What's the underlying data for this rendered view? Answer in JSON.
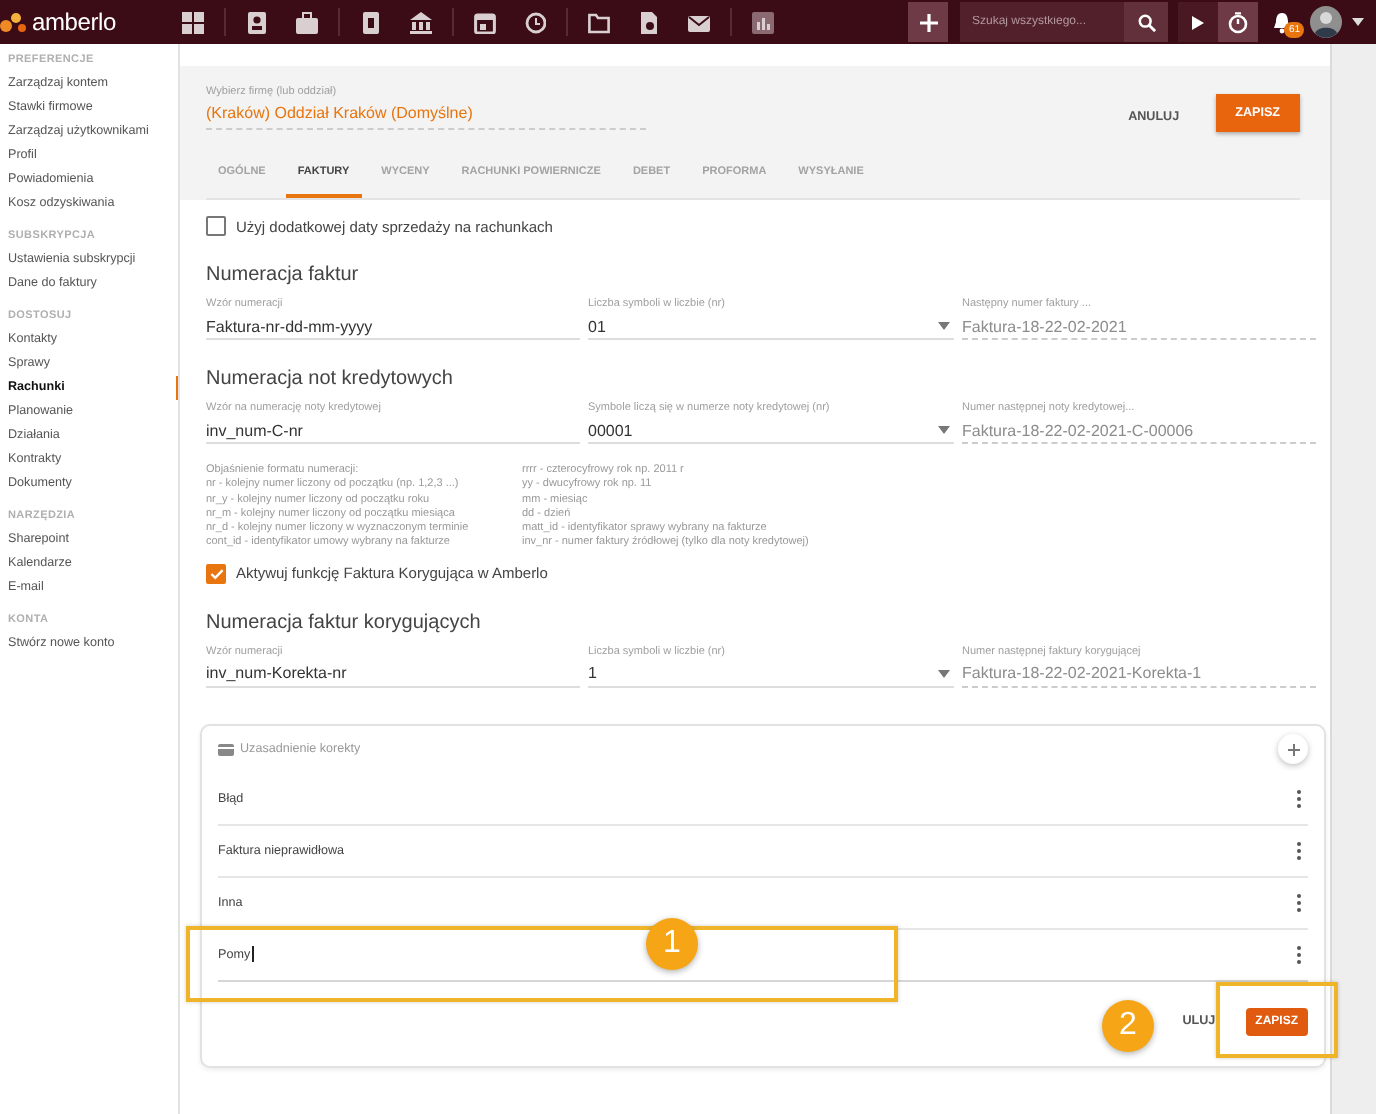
{
  "topbar": {
    "logo": "amberlo",
    "search": {
      "placeholder": "Szukaj wszystkiego..."
    },
    "notifications": "61"
  },
  "sidebar": {
    "sections": [
      {
        "title": "PREFERENCJE",
        "items": [
          {
            "label": "Zarządzaj kontem",
            "selected": false
          },
          {
            "label": "Stawki firmowe",
            "selected": false
          },
          {
            "label": "Zarządzaj użytkownikami",
            "selected": false
          },
          {
            "label": "Profil",
            "selected": false
          },
          {
            "label": "Powiadomienia",
            "selected": false
          },
          {
            "label": "Kosz odzyskiwania",
            "selected": false
          }
        ]
      },
      {
        "title": "SUBSKRYPCJA",
        "items": [
          {
            "label": "Ustawienia subskrypcji",
            "selected": false
          },
          {
            "label": "Dane do faktury",
            "selected": false
          }
        ]
      },
      {
        "title": "DOSTOSUJ",
        "items": [
          {
            "label": "Kontakty",
            "selected": false
          },
          {
            "label": "Sprawy",
            "selected": false
          },
          {
            "label": "Rachunki",
            "selected": true
          },
          {
            "label": "Planowanie",
            "selected": false
          },
          {
            "label": "Działania",
            "selected": false
          },
          {
            "label": "Kontrakty",
            "selected": false
          },
          {
            "label": "Dokumenty",
            "selected": false
          }
        ]
      },
      {
        "title": "NARZĘDZIA",
        "items": [
          {
            "label": "Sharepoint",
            "selected": false
          },
          {
            "label": "Kalendarze",
            "selected": false
          },
          {
            "label": "E-mail",
            "selected": false
          }
        ]
      },
      {
        "title": "KONTA",
        "items": [
          {
            "label": "Stwórz nowe konto",
            "selected": false
          }
        ]
      }
    ]
  },
  "company": {
    "label": "Wybierz firmę (lub oddział)",
    "value": "(Kraków) Oddział Kraków (Domyślne)"
  },
  "header_actions": {
    "cancel": "ANULUJ",
    "save": "ZAPISZ"
  },
  "tabs": [
    {
      "label": "OGÓLNE",
      "selected": false
    },
    {
      "label": "FAKTURY",
      "selected": true
    },
    {
      "label": "WYCENY",
      "selected": false
    },
    {
      "label": "RACHUNKI POWIERNICZE",
      "selected": false
    },
    {
      "label": "DEBET",
      "selected": false
    },
    {
      "label": "PROFORMA",
      "selected": false
    },
    {
      "label": "WYSYŁANIE",
      "selected": false
    }
  ],
  "extra_sale_date": {
    "label": "Użyj dodatkowej daty sprzedaży na rachunkach",
    "checked": false
  },
  "invoice_numbering": {
    "title": "Numeracja faktur",
    "fields": [
      {
        "kind": "text",
        "label": "Wzór numeracji",
        "value": "Faktura-nr-dd-mm-yyyy"
      },
      {
        "kind": "select",
        "label": "Liczba symboli w liczbie (nr)",
        "value": "01"
      },
      {
        "kind": "readonly",
        "label": "Następny numer faktury ...",
        "value": "Faktura-18-22-02-2021"
      }
    ]
  },
  "credit_note_numbering": {
    "title": "Numeracja not kredytowych",
    "fields": [
      {
        "kind": "text",
        "label": "Wzór na numerację noty kredytowej",
        "value": "inv_num-C-nr"
      },
      {
        "kind": "select",
        "label": "Symbole liczą się w numerze noty kredytowej (nr)",
        "value": "00001"
      },
      {
        "kind": "readonly",
        "label": "Numer następnej noty kredytowej...",
        "value": "Faktura-18-22-02-2021-C-00006"
      }
    ]
  },
  "format_legend": {
    "columns": [
      [
        "Objaśnienie formatu numeracji:",
        "nr - kolejny numer liczony od początku (np. 1,2,3 ...)",
        "nr_y - kolejny numer liczony od początku roku",
        "nr_m - kolejny numer liczony od początku miesiąca",
        "nr_d - kolejny numer liczony w wyznaczonym terminie",
        "cont_id - identyfikator umowy wybrany na fakturze"
      ],
      [
        "rrrr - czterocyfrowy rok np. 2011 r",
        "yy - dwucyfrowy rok np. 11",
        "mm - miesiąc",
        "dd - dzień",
        "matt_id - identyfikator sprawy wybrany na fakturze",
        "inv_nr - numer faktury źródłowej (tylko dla noty kredytowej)"
      ]
    ]
  },
  "corrective_invoice": {
    "label": "Aktywuj funkcję Faktura Korygująca w Amberlo",
    "checked": true
  },
  "corrective_numbering": {
    "title": "Numeracja faktur korygujących",
    "fields": [
      {
        "kind": "text",
        "label": "Wzór numeracji",
        "value": "inv_num-Korekta-nr"
      },
      {
        "kind": "select",
        "label": "Liczba symboli w liczbie (nr)",
        "value": "1"
      },
      {
        "kind": "readonly",
        "label": "Numer następnej faktury korygującej",
        "value": "Faktura-18-22-02-2021-Korekta-1"
      }
    ]
  },
  "correction_reasons": {
    "title": "Uzasadnienie korekty",
    "items": [
      {
        "kind": "text",
        "value": "Błąd"
      },
      {
        "kind": "text",
        "value": "Faktura nieprawidłowa"
      },
      {
        "kind": "text",
        "value": "Inna"
      },
      {
        "kind": "input",
        "value": "Pomy"
      }
    ],
    "cancel": "ULUJ",
    "save": "ZAPISZ"
  },
  "annotations": [
    {
      "label": "1"
    },
    {
      "label": "2"
    }
  ]
}
